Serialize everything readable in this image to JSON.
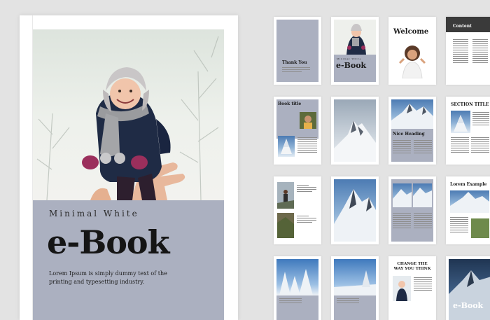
{
  "cover": {
    "subtitle": "Minimal White",
    "title": "e-Book",
    "body": "Lorem Ipsum is simply dummy text of the printing and typesetting industry."
  },
  "pages": {
    "thank_you": "Thank You",
    "ebook_small_subtitle": "Minimal White",
    "ebook_small_title": "e-Book",
    "welcome": "Welcome",
    "contents": "Content",
    "book_title": "Book title",
    "nice_heading": "Nice Heading",
    "section_title": "SECTION TITLE",
    "lorem_example": "Lorem Example",
    "change_the_way": "CHANGE THE WAY YOU THINK",
    "last_ebook": "e-Book"
  },
  "colors": {
    "panel": "#abb0c0",
    "background": "#e3e3e3",
    "paper": "#ffffff",
    "dark_header": "#3a3a3a"
  }
}
